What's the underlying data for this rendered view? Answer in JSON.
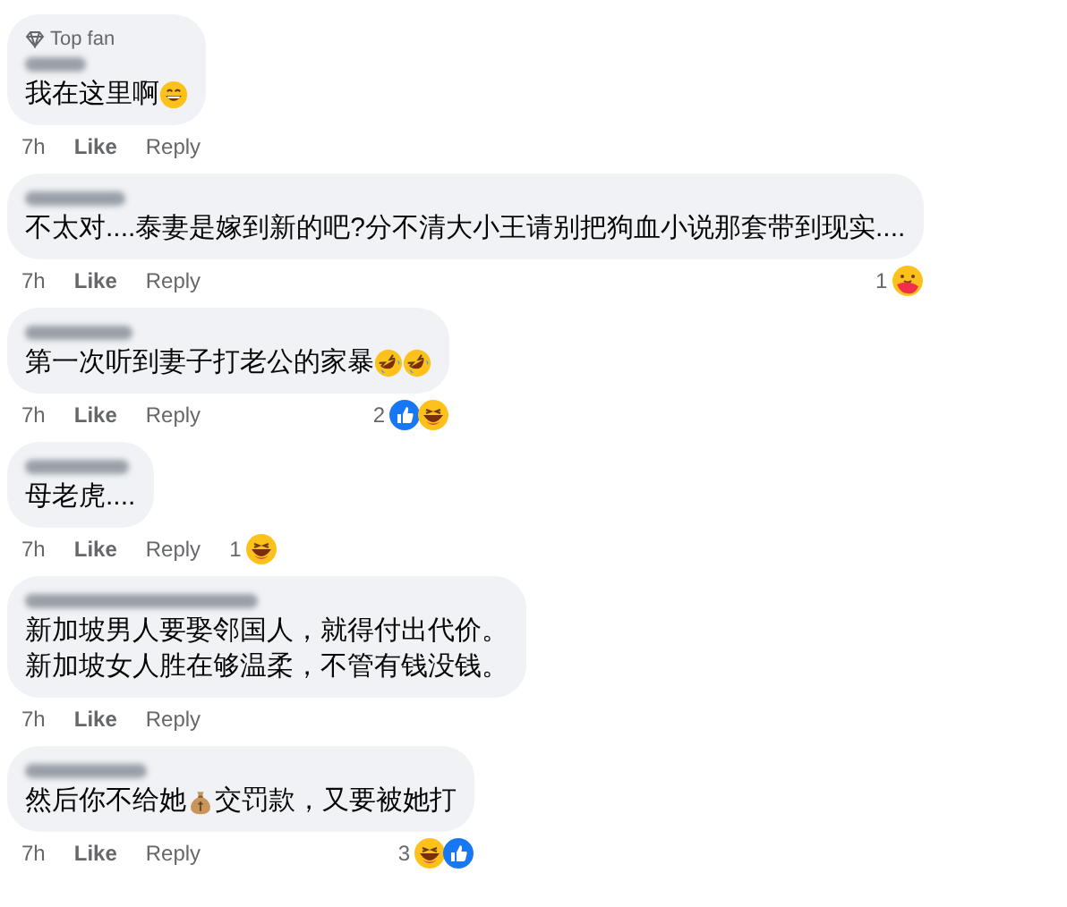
{
  "comments": [
    {
      "badge": "Top fan",
      "body": [
        [
          {
            "kind": "text",
            "text": "我在这里啊"
          },
          {
            "kind": "grin"
          }
        ]
      ],
      "time": "7h",
      "like": "Like",
      "reply": "Reply"
    },
    {
      "body": [
        [
          {
            "kind": "text",
            "text": "不太对....泰妻是嫁到新的吧?分不清大小王请别把狗血小说那套带到现实...."
          }
        ]
      ],
      "time": "7h",
      "like": "Like",
      "reply": "Reply",
      "reactions": {
        "count": "1",
        "icons": [
          {
            "kind": "care"
          }
        ]
      }
    },
    {
      "body": [
        [
          {
            "kind": "text",
            "text": "第一次听到妻子打老公的家暴"
          },
          {
            "kind": "rofl"
          },
          {
            "kind": "rofl"
          }
        ]
      ],
      "time": "7h",
      "like": "Like",
      "reply": "Reply",
      "reactions": {
        "count": "2",
        "icons": [
          {
            "kind": "like"
          },
          {
            "kind": "haha"
          }
        ]
      }
    },
    {
      "body": [
        [
          {
            "kind": "text",
            "text": "母老虎...."
          }
        ]
      ],
      "time": "7h",
      "like": "Like",
      "reply": "Reply",
      "reactions": {
        "count": "1",
        "icons": [
          {
            "kind": "haha"
          }
        ]
      }
    },
    {
      "body": [
        [
          {
            "kind": "text",
            "text": "新加坡男人要娶邻国人，就得付出代价。"
          }
        ],
        [
          {
            "kind": "text",
            "text": "新加坡女人胜在够温柔，不管有钱没钱。"
          }
        ]
      ],
      "time": "7h",
      "like": "Like",
      "reply": "Reply"
    },
    {
      "body": [
        [
          {
            "kind": "text",
            "text": "然后你不给她"
          },
          {
            "kind": "moneybag"
          },
          {
            "kind": "text",
            "text": "交罚款，又要被她打"
          }
        ]
      ],
      "time": "7h",
      "like": "Like",
      "reply": "Reply",
      "reactions": {
        "count": "3",
        "icons": [
          {
            "kind": "haha"
          },
          {
            "kind": "like"
          }
        ]
      }
    }
  ]
}
